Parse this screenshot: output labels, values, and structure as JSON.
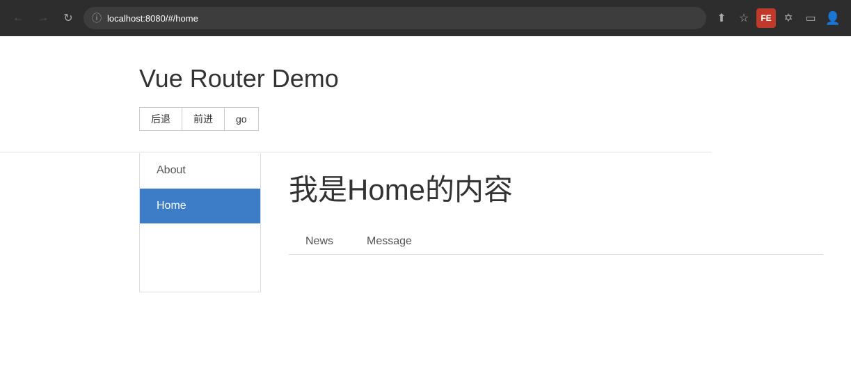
{
  "browser": {
    "url": "localhost:8080/#/home",
    "back_icon": "←",
    "forward_icon": "→",
    "refresh_icon": "↻",
    "info_icon": "ⓘ",
    "share_icon": "⬆",
    "bookmark_icon": "☆",
    "fe_label": "FE",
    "puzzle_icon": "⧉",
    "sidebar_icon": "▣",
    "profile_icon": "👤"
  },
  "app": {
    "title": "Vue Router Demo",
    "nav_buttons": {
      "back_label": "后退",
      "forward_label": "前进",
      "go_label": "go"
    }
  },
  "sidebar": {
    "items": [
      {
        "label": "About",
        "active": false,
        "id": "about"
      },
      {
        "label": "Home",
        "active": true,
        "id": "home"
      }
    ]
  },
  "home_view": {
    "content_title": "我是Home的内容",
    "sub_tabs": [
      {
        "label": "News",
        "active": false,
        "id": "news"
      },
      {
        "label": "Message",
        "active": false,
        "id": "message"
      }
    ]
  }
}
